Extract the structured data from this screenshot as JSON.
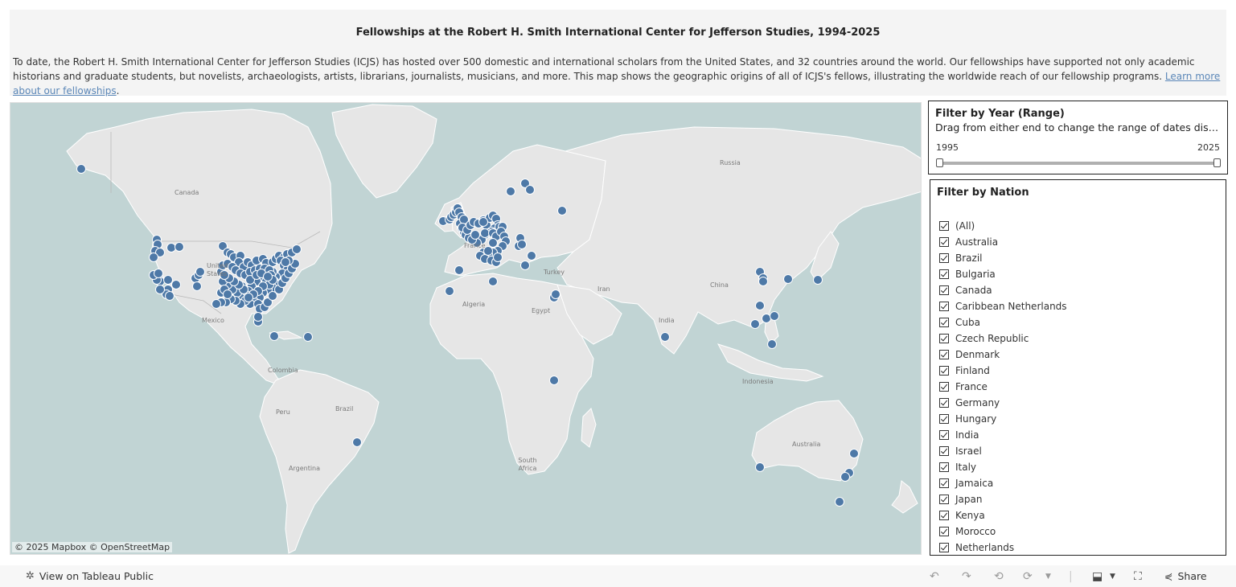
{
  "header": {
    "title": "Fellowships at the Robert H. Smith International Center for Jefferson Studies, 1994-2025",
    "description": "To date, the Robert H. Smith International Center for Jefferson Studies (ICJS) has hosted over 500 domestic and international scholars from the United States, and 32 countries around the world. Our fellowships have supported not only academic historians and graduate students, but novelists, archaeologists, artists, librarians, journalists, musicians, and more. This map shows the geographic origins of all of ICJS's fellows, illustrating the worldwide reach of our fellowship programs. ",
    "link_text": "Learn more about our fellowships",
    "after_link": "."
  },
  "map": {
    "attribution": "© 2025 Mapbox  © OpenStreetMap",
    "labels": {
      "canada": "Canada",
      "united_states": "United States",
      "mexico": "Mexico",
      "colombia": "Colombia",
      "peru": "Peru",
      "brazil": "Brazil",
      "argentina": "Argentina",
      "algeria": "Algeria",
      "egypt": "Egypt",
      "south_africa": "South Africa",
      "russia": "Russia",
      "iran": "Iran",
      "china": "China",
      "india": "India",
      "indonesia": "Indonesia",
      "australia": "Australia",
      "turkey": "Turkey",
      "france": "France"
    },
    "marker_color": "#4e79a7",
    "land_color": "#e6e6e6",
    "water_color": "#c1d4d4"
  },
  "year_filter": {
    "title": "Filter by Year (Range)",
    "instruction": "Drag from either end to change the range of dates displayed",
    "min_label": "1995",
    "max_label": "2025"
  },
  "nation_filter": {
    "title": "Filter by Nation",
    "items": [
      "(All)",
      "Australia",
      "Brazil",
      "Bulgaria",
      "Canada",
      "Caribbean Netherlands",
      "Cuba",
      "Czech Republic",
      "Denmark",
      "Finland",
      "France",
      "Germany",
      "Hungary",
      "India",
      "Israel",
      "Italy",
      "Jamaica",
      "Japan",
      "Kenya",
      "Morocco",
      "Netherlands"
    ]
  },
  "footer": {
    "view_label": "View on Tableau Public",
    "share_label": "Share"
  }
}
